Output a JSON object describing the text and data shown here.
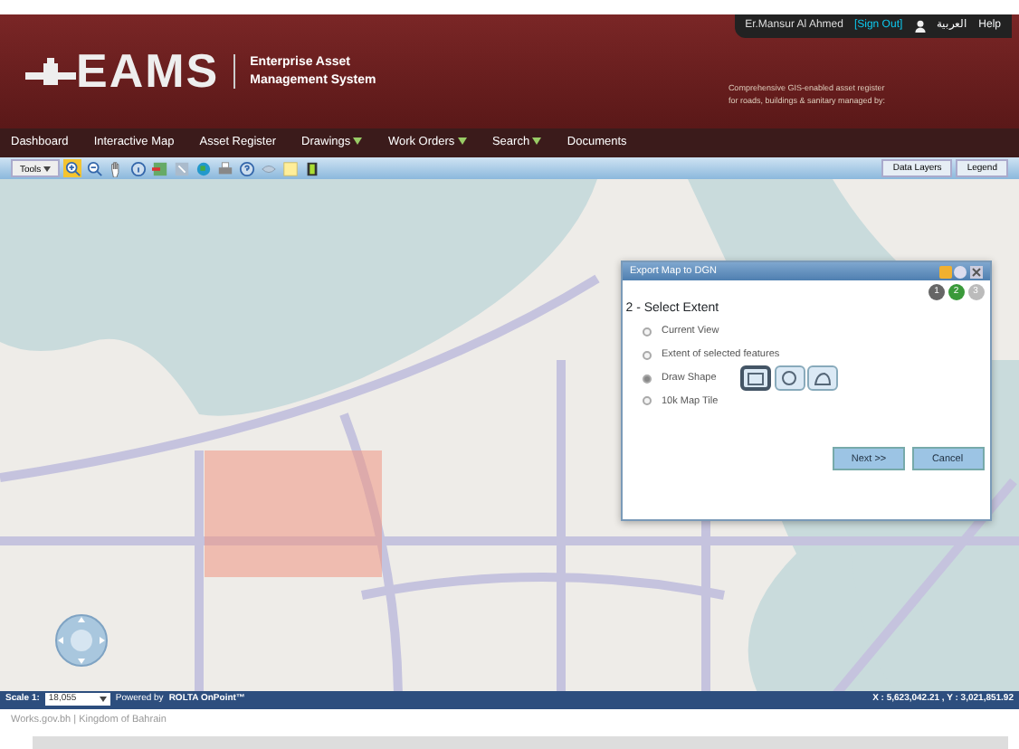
{
  "header": {
    "user": "Er.Mansur Al Ahmed",
    "sign_out": "[Sign Out]",
    "language": "العربية",
    "help": "Help",
    "logo": "EAMS",
    "subtitle_line_1": "Enterprise Asset",
    "subtitle_line_2": "Management System",
    "tagline_line_1": "Comprehensive GIS-enabled asset register",
    "tagline_line_2": "for roads, buildings & sanitary managed by:"
  },
  "nav": [
    {
      "label": "Dashboard",
      "dropdown": false
    },
    {
      "label": "Interactive Map",
      "dropdown": false
    },
    {
      "label": "Asset Register",
      "dropdown": false
    },
    {
      "label": "Drawings",
      "dropdown": true
    },
    {
      "label": "Work Orders",
      "dropdown": true
    },
    {
      "label": "Search",
      "dropdown": true
    },
    {
      "label": "Documents",
      "dropdown": false
    }
  ],
  "toolbar": {
    "tools": "Tools",
    "buttons": [
      {
        "kind": "zoom-in",
        "selected": true
      },
      {
        "kind": "zoom-out",
        "selected": false
      },
      {
        "kind": "hand",
        "selected": false
      },
      {
        "kind": "info",
        "selected": false
      },
      {
        "kind": "export",
        "selected": false
      },
      {
        "kind": "select",
        "selected": false
      },
      {
        "kind": "globe",
        "selected": false
      },
      {
        "kind": "print",
        "selected": false
      },
      {
        "kind": "help",
        "selected": false
      },
      {
        "kind": "eye",
        "selected": false
      },
      {
        "kind": "note",
        "selected": false
      },
      {
        "kind": "film",
        "selected": false
      }
    ],
    "right": [
      "Data Layers",
      "Legend"
    ]
  },
  "dialog": {
    "title": "Export Map to DGN",
    "steps": [
      {
        "label": "1",
        "selected": false
      },
      {
        "label": "2",
        "selected": true
      },
      {
        "label": "3",
        "selected": false
      }
    ],
    "heading": "2 - Select Extent",
    "options": [
      {
        "label": "Current View",
        "selected": false
      },
      {
        "label": "Extent of selected features",
        "selected": false
      },
      {
        "label": "Draw Shape",
        "selected": true
      },
      {
        "label": "10k Map Tile",
        "selected": false
      }
    ],
    "shapes": [
      {
        "kind": "rectangle",
        "selected": true
      },
      {
        "kind": "circle",
        "selected": false
      },
      {
        "kind": "freehand",
        "selected": false
      }
    ],
    "buttons": [
      "Next >>",
      "Cancel"
    ]
  },
  "status_bar": {
    "scale_label": "Scale 1:",
    "scale": "18,055",
    "powered": "Powered by",
    "brand": "ROLTA OnPoint™",
    "coordinates": "X : 5,623,042.21 , Y : 3,021,851.92"
  },
  "footer": "Works.gov.bh | Kingdom of Bahrain"
}
